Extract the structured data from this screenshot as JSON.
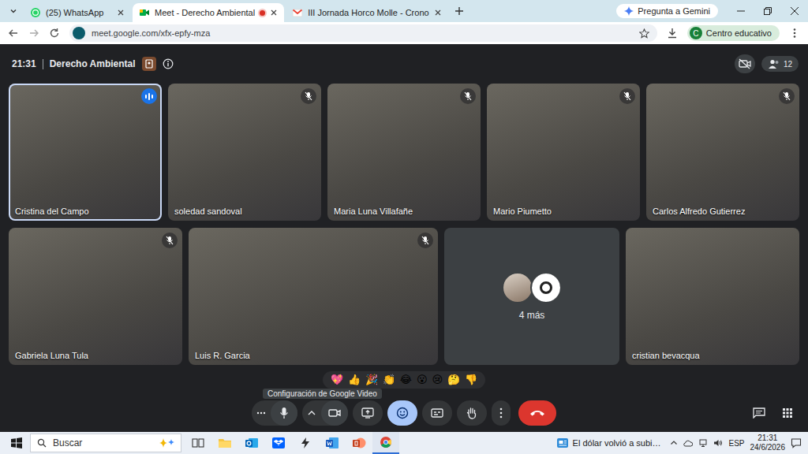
{
  "browser": {
    "tabs": [
      {
        "label": "(25) WhatsApp",
        "selected": false,
        "recording": false
      },
      {
        "label": "Meet - Derecho Ambiental",
        "selected": true,
        "recording": true
      },
      {
        "label": "III Jornada Horco Molle - Crono",
        "selected": false,
        "recording": false
      }
    ],
    "gemini_button": "Pregunta a Gemini",
    "url": "meet.google.com/xfx-epfy-mza",
    "profile": {
      "initial": "C",
      "label": "Centro educativo"
    }
  },
  "meeting": {
    "time": "21:31",
    "title": "Derecho Ambiental",
    "participants_count": "12"
  },
  "tiles": [
    {
      "kind": "video",
      "name": "Cristina del Campo",
      "speaking": true,
      "muted": false
    },
    {
      "kind": "video",
      "name": "soledad sandoval",
      "speaking": false,
      "muted": true
    },
    {
      "kind": "video",
      "name": "Maria Luna Villafañe",
      "speaking": false,
      "muted": true
    },
    {
      "kind": "video",
      "name": "Mario Piumetto",
      "speaking": false,
      "muted": true
    },
    {
      "kind": "video",
      "name": "Carlos Alfredo Gutierrez",
      "speaking": false,
      "muted": true
    },
    {
      "kind": "video",
      "name": "Gabriela Luna Tula",
      "speaking": false,
      "muted": true
    },
    {
      "kind": "video",
      "name": "Luis R. Garcia",
      "speaking": false,
      "muted": true
    },
    {
      "kind": "overflow",
      "name": "4 más",
      "speaking": false,
      "muted": false
    },
    {
      "kind": "video",
      "name": "cristian bevacqua",
      "speaking": false,
      "muted": false
    }
  ],
  "reactions": [
    "💖",
    "👍",
    "🎉",
    "👏",
    "😂",
    "😮",
    "😢",
    "🤔",
    "👎"
  ],
  "tooltip": "Configuración de Google Video",
  "controls": {
    "mic_on": true,
    "camera_on": true,
    "reactions_selected": true,
    "captions_on": false,
    "hand_raised": false
  },
  "taskbar": {
    "search_placeholder": "Buscar",
    "news": "El dólar volvió a subi…",
    "language": "ESP",
    "time": "21:31",
    "date": "24/6/2026"
  }
}
